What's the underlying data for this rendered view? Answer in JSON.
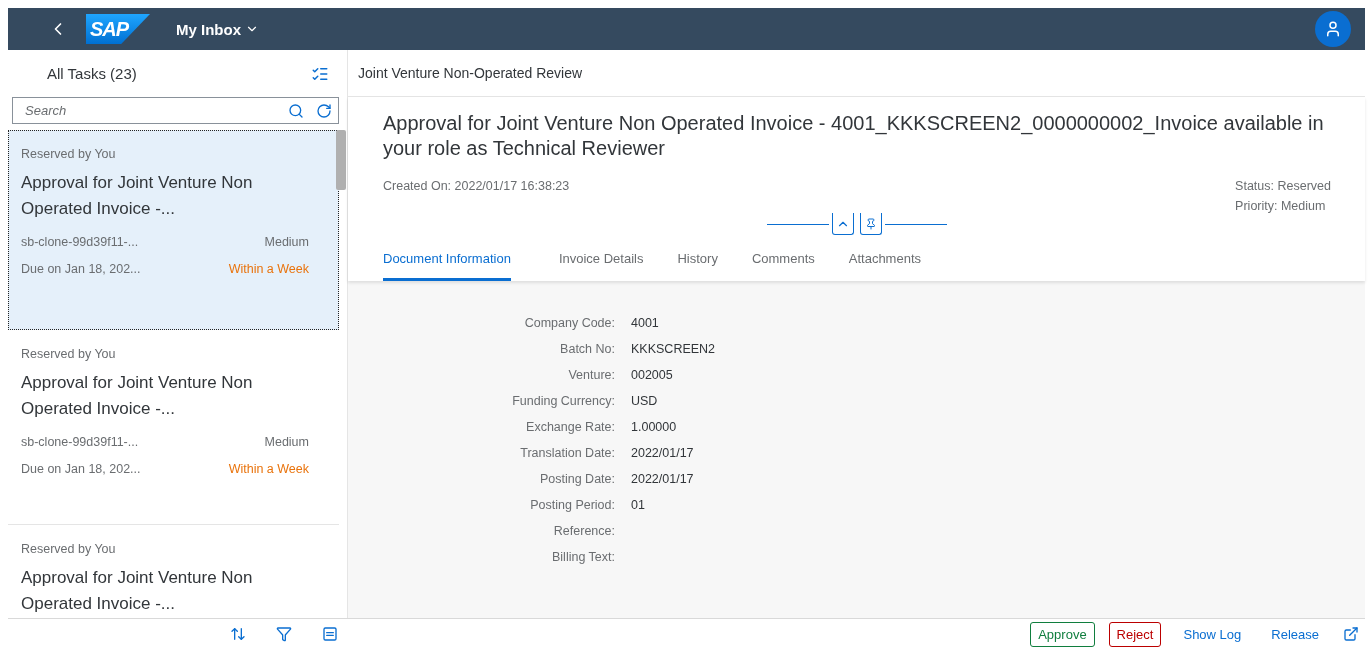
{
  "shell": {
    "logo": "SAP",
    "title": "My Inbox"
  },
  "list": {
    "heading": "All Tasks (23)",
    "search": {
      "placeholder": "Search"
    },
    "tasks": [
      {
        "status": "Reserved by You",
        "title": "Approval for Joint Venture Non Operated Invoice -...",
        "id": "sb-clone-99d39f11-...",
        "priority": "Medium",
        "due": "Due on Jan 18, 202...",
        "due_status": "Within a Week",
        "selected": true
      },
      {
        "status": "Reserved by You",
        "title": "Approval for Joint Venture Non Operated Invoice -...",
        "id": "sb-clone-99d39f11-...",
        "priority": "Medium",
        "due": "Due on Jan 18, 202...",
        "due_status": "Within a Week",
        "selected": false
      },
      {
        "status": "Reserved by You",
        "title": "Approval for Joint Venture Non Operated Invoice -...",
        "selected": false
      }
    ]
  },
  "detail": {
    "heading": "Joint Venture Non-Operated Review",
    "title": "Approval for Joint Venture Non Operated Invoice - 4001_KKKSCREEN2_0000000002_Invoice available in your role as Technical Reviewer",
    "created": "Created On: 2022/01/17 16:38:23",
    "status": "Status: Reserved",
    "priority": "Priority: Medium",
    "tabs": [
      {
        "label": "Document Information",
        "selected": true
      },
      {
        "label": "Invoice Details",
        "selected": false
      },
      {
        "label": "History",
        "selected": false
      },
      {
        "label": "Comments",
        "selected": false
      },
      {
        "label": "Attachments",
        "selected": false
      }
    ],
    "fields": [
      {
        "label": "Company Code:",
        "value": "4001"
      },
      {
        "label": "Batch No:",
        "value": "KKKSCREEN2"
      },
      {
        "label": "Venture:",
        "value": "002005"
      },
      {
        "label": "Funding Currency:",
        "value": "USD"
      },
      {
        "label": "Exchange Rate:",
        "value": "1.00000"
      },
      {
        "label": "Translation Date:",
        "value": "2022/01/17"
      },
      {
        "label": "Posting Date:",
        "value": "2022/01/17"
      },
      {
        "label": "Posting Period:",
        "value": "01"
      },
      {
        "label": "Reference:"
      },
      {
        "label": "Billing Text:"
      }
    ]
  },
  "actions": [
    {
      "label": "Approve",
      "kind": "accept"
    },
    {
      "label": "Reject",
      "kind": "reject"
    },
    {
      "label": "Show Log",
      "kind": "plain"
    },
    {
      "label": "Release",
      "kind": "plain"
    }
  ]
}
